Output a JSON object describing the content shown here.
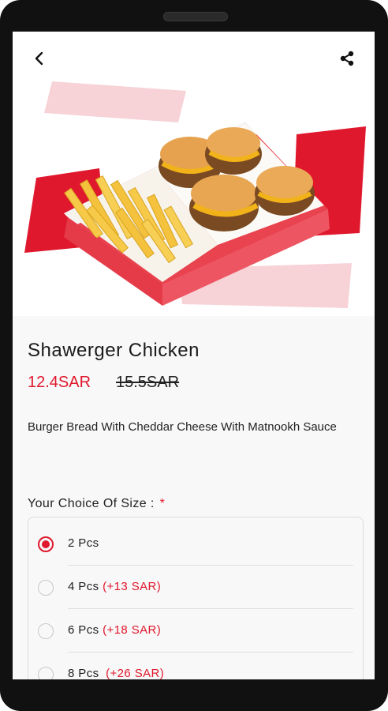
{
  "header": {
    "back_icon": "chevron-left-icon",
    "share_icon": "share-icon"
  },
  "product": {
    "name": "Shawerger Chicken",
    "price": "12.4SAR",
    "old_price": "15.5SAR",
    "description": "Burger Bread With Cheddar Cheese With Matnookh Sauce"
  },
  "size_section": {
    "title": "Your Choice Of Size :",
    "required_mark": "*",
    "options": [
      {
        "label": "2 Pcs",
        "extra": "",
        "selected": true
      },
      {
        "label": "4 Pcs",
        "extra": "(+13 SAR)",
        "selected": false
      },
      {
        "label": "6 Pcs",
        "extra": "(+18 SAR)",
        "selected": false
      },
      {
        "label": "8 Pcs",
        "extra": "(+26 SAR)",
        "selected": false
      }
    ]
  },
  "colors": {
    "accent": "#e0182d",
    "background": "#f8f8f8"
  }
}
